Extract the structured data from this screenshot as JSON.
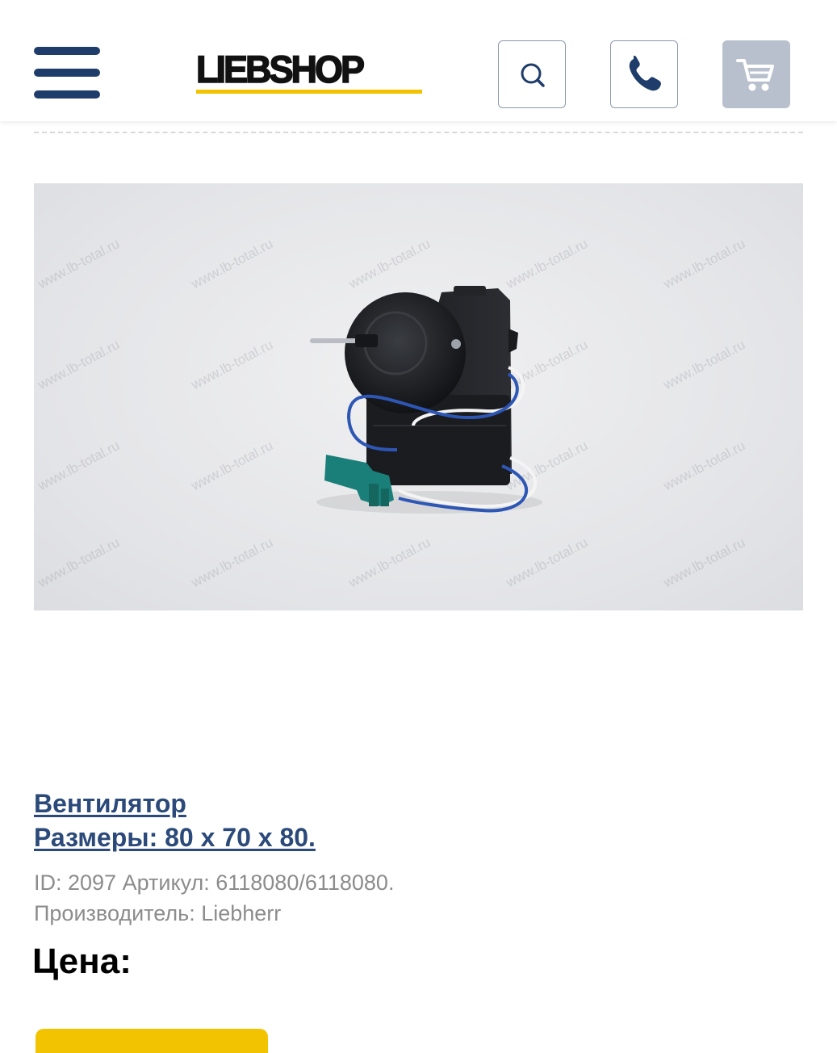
{
  "header": {
    "logo_text": "LIEBSHOP",
    "menu_icon": "hamburger-menu-icon",
    "search_icon": "search-icon",
    "phone_icon": "phone-icon",
    "cart_icon": "cart-icon",
    "brand_color": "#1f3d6b",
    "accent_color": "#f2c300"
  },
  "product": {
    "image_watermark": "www.lb-total.ru",
    "title_line1": "Вентилятор",
    "title_line2": "Размеры: 80 х 70 х 80.",
    "id_line": "ID: 2097 Артикул: 6118080/6118080.",
    "manufacturer_line": "Производитель: Liebherr",
    "price_label": "Цена:"
  }
}
